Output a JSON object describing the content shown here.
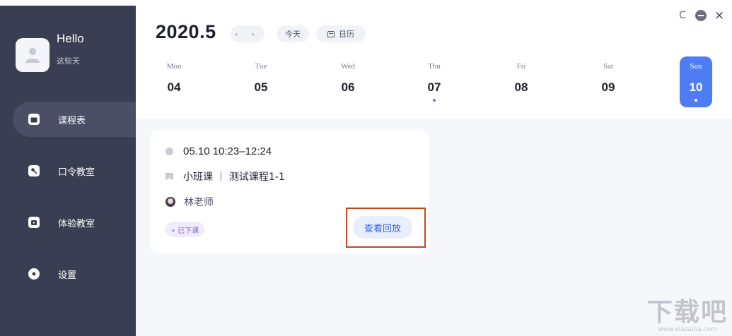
{
  "sidebar": {
    "greeting": "Hello",
    "subtitle": "这些天",
    "items": [
      {
        "label": "课程表",
        "icon": "calendar-icon",
        "active": true
      },
      {
        "label": "口令教室",
        "icon": "key-icon",
        "active": false
      },
      {
        "label": "体验教室",
        "icon": "video-icon",
        "active": false
      },
      {
        "label": "设置",
        "icon": "gear-icon",
        "active": false
      }
    ]
  },
  "header": {
    "month": "2020.5",
    "prev_next": "‹ ›",
    "today_label": "今天",
    "calendar_label": "日历"
  },
  "window_controls": {
    "refresh": "C",
    "close": "×"
  },
  "week": [
    {
      "name": "Mon",
      "num": "04",
      "dot": false,
      "selected": false
    },
    {
      "name": "Tue",
      "num": "05",
      "dot": false,
      "selected": false
    },
    {
      "name": "Wed",
      "num": "06",
      "dot": false,
      "selected": false
    },
    {
      "name": "Thu",
      "num": "07",
      "dot": true,
      "selected": false
    },
    {
      "name": "Fri",
      "num": "08",
      "dot": false,
      "selected": false
    },
    {
      "name": "Sat",
      "num": "09",
      "dot": false,
      "selected": false
    },
    {
      "name": "Sun",
      "num": "10",
      "dot": true,
      "selected": true
    }
  ],
  "course_card": {
    "time": "05.10  10:23–12:24",
    "course": "小班课 ｜ 测试课程1-1",
    "teacher": "林老师",
    "status": "• 已下课",
    "replay_label": "查看回放"
  },
  "watermark": {
    "main": "下载吧",
    "sub": "www.xiazaiba.com"
  },
  "colors": {
    "sidebar_bg": "#3a3e52",
    "accent": "#4e7cf5",
    "highlight": "#c5451e"
  }
}
